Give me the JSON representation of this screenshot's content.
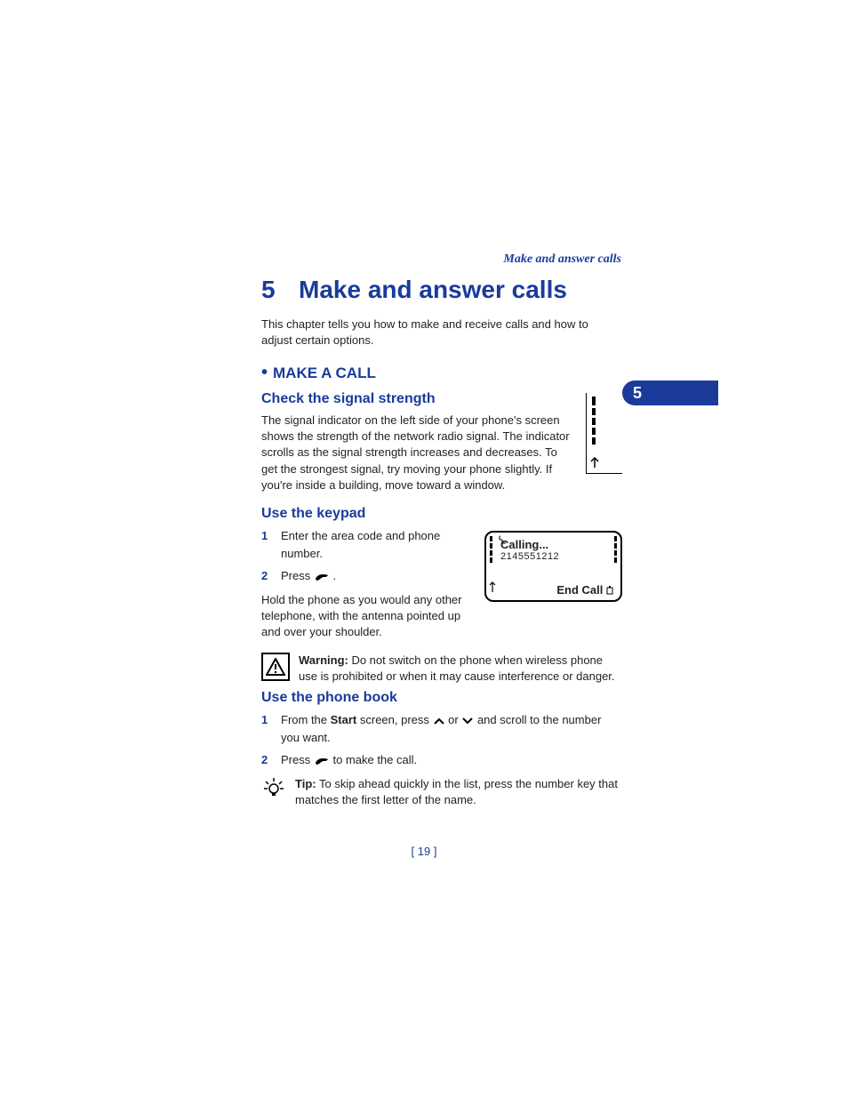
{
  "running_header": "Make and answer calls",
  "chapter": {
    "number": "5",
    "title": "Make and answer calls"
  },
  "intro": "This chapter tells you how to make and receive calls and how to adjust certain options.",
  "side_tab": "5",
  "section_make_call": {
    "heading": "MAKE A CALL"
  },
  "sub_signal": {
    "heading": "Check the signal strength",
    "body": "The signal indicator on the left side of your phone's screen shows the strength of the network radio signal. The indicator scrolls as the signal strength increases and decreases. To get the strongest signal, try moving your phone slightly. If you're inside a building, move toward a window."
  },
  "sub_keypad": {
    "heading": "Use the keypad",
    "step1": "Enter the area code and phone number.",
    "step2_prefix": "Press ",
    "step2_suffix": ".",
    "hold_body": "Hold the phone as you would any other telephone, with the antenna pointed up and over your shoulder.",
    "screen": {
      "calling": "Calling...",
      "number": "2145551212",
      "end_call": "End Call"
    },
    "warning_label": "Warning:",
    "warning_text": " Do not switch on the phone when wireless phone use is prohibited or when it may cause interference or danger."
  },
  "sub_phonebook": {
    "heading": "Use the phone book",
    "step1_prefix": "From the ",
    "step1_bold": "Start",
    "step1_mid": " screen, press ",
    "step1_or": " or ",
    "step1_suffix": " and scroll to the number you want.",
    "step2_prefix": "Press ",
    "step2_suffix": " to make the call.",
    "tip_label": "Tip:",
    "tip_text": " To skip ahead quickly in the list, press the number key that matches the first letter of the name."
  },
  "page_number": "[ 19 ]"
}
